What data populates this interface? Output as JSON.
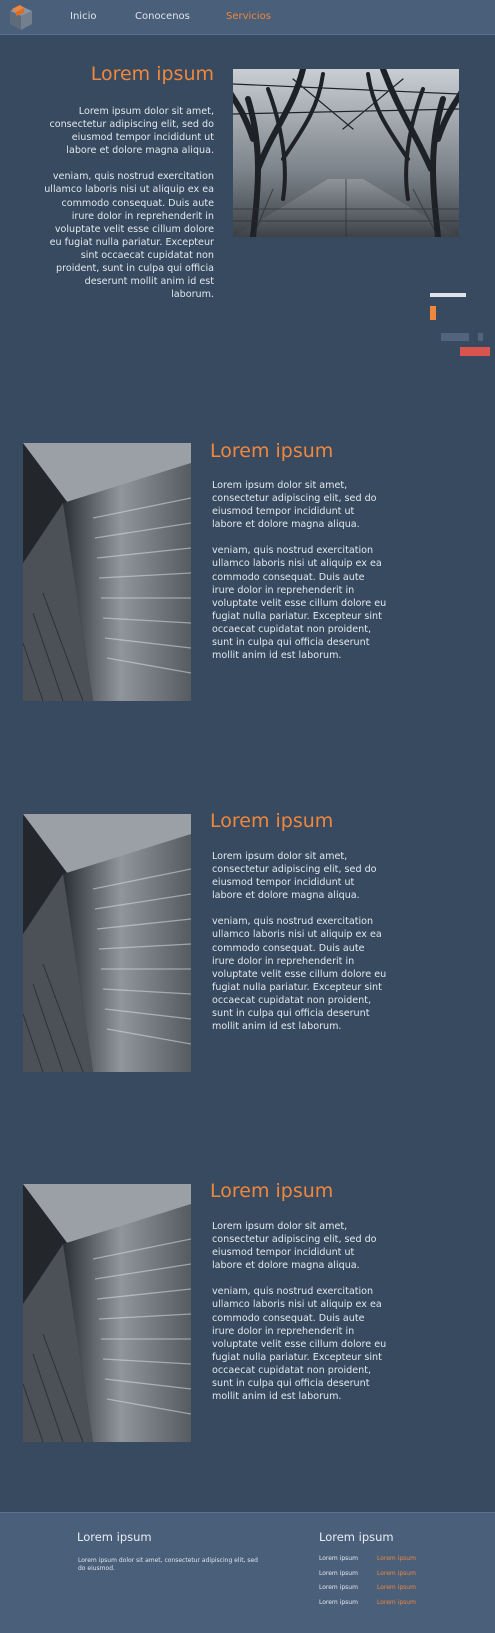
{
  "nav": {
    "items": [
      "Inicio",
      "Conocenos",
      "Servicios"
    ],
    "active_index": 2
  },
  "hero": {
    "title": "Lorem ipsum",
    "paragraph1": "Lorem ipsum dolor sit amet, consectetur adipiscing elit, sed do eiusmod tempor incididunt ut labore et dolore magna aliqua.",
    "paragraph2": "veniam, quis nostrud exercitation ullamco laboris nisi ut aliquip ex ea commodo consequat. Duis aute irure dolor in reprehenderit in voluptate velit esse cillum dolore eu fugiat nulla pariatur. Excepteur sint occaecat cupidatat non proident, sunt in culpa qui officia deserunt mollit anim id est laborum."
  },
  "sections": [
    {
      "title": "Lorem ipsum",
      "paragraph1": "Lorem ipsum dolor sit amet, consectetur adipiscing elit, sed do eiusmod tempor incididunt ut labore et dolore magna aliqua.",
      "paragraph2": "veniam, quis nostrud exercitation ullamco laboris nisi ut aliquip ex ea commodo consequat. Duis aute irure dolor in reprehenderit in voluptate velit esse cillum dolore eu fugiat nulla pariatur. Excepteur sint occaecat cupidatat non proident, sunt in culpa qui officia deserunt mollit anim id est laborum."
    },
    {
      "title": "Lorem ipsum",
      "paragraph1": "Lorem ipsum dolor sit amet, consectetur adipiscing elit, sed do eiusmod tempor incididunt ut labore et dolore magna aliqua.",
      "paragraph2": "veniam, quis nostrud exercitation ullamco laboris nisi ut aliquip ex ea commodo consequat. Duis aute irure dolor in reprehenderit in voluptate velit esse cillum dolore eu fugiat nulla pariatur. Excepteur sint occaecat cupidatat non proident, sunt in culpa qui officia deserunt mollit anim id est laborum."
    },
    {
      "title": "Lorem ipsum",
      "paragraph1": "Lorem ipsum dolor sit amet, consectetur adipiscing elit, sed do eiusmod tempor incididunt ut labore et dolore magna aliqua.",
      "paragraph2": "veniam, quis nostrud exercitation ullamco laboris nisi ut aliquip ex ea commodo consequat. Duis aute irure dolor in reprehenderit in voluptate velit esse cillum dolore eu fugiat nulla pariatur. Excepteur sint occaecat cupidatat non proident, sunt in culpa qui officia deserunt mollit anim id est laborum."
    }
  ],
  "footer": {
    "left_title": "Lorem ipsum",
    "left_text": "Lorem ipsum dolor sit amet, consectetur adipiscing elit, sed do eiusmod.",
    "right_title": "Lorem ipsum",
    "links_col1": [
      "Lorem ipsum",
      "Lorem ipsum",
      "Lorem ipsum",
      "Lorem ipsum"
    ],
    "links_col2": [
      "Lorem ipsum",
      "Lorem ipsum",
      "Lorem ipsum",
      "Lorem ipsum"
    ]
  },
  "colors": {
    "accent": "#f0873d",
    "background": "#374a5f",
    "nav_background": "#4a5f7a",
    "deco_red": "#d9534f"
  },
  "icons": {
    "logo": "cube-logo-icon"
  }
}
